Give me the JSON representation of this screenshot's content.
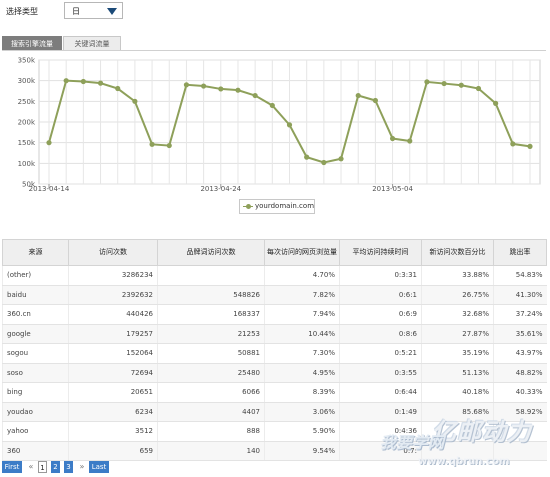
{
  "filter": {
    "label": "选择类型",
    "selected": "日"
  },
  "tabs": [
    {
      "label": "搜索引擎流量",
      "active": true
    },
    {
      "label": "关键词流量",
      "active": false
    }
  ],
  "chart_data": {
    "type": "line",
    "x": [
      "2013-04-14",
      "2013-04-15",
      "2013-04-16",
      "2013-04-17",
      "2013-04-18",
      "2013-04-19",
      "2013-04-20",
      "2013-04-21",
      "2013-04-22",
      "2013-04-23",
      "2013-04-24",
      "2013-04-25",
      "2013-04-26",
      "2013-04-27",
      "2013-04-28",
      "2013-04-29",
      "2013-04-30",
      "2013-05-01",
      "2013-05-02",
      "2013-05-03",
      "2013-05-04",
      "2013-05-05",
      "2013-05-06",
      "2013-05-07",
      "2013-05-08",
      "2013-05-09",
      "2013-05-10",
      "2013-05-11",
      "2013-05-12"
    ],
    "x_tick_labels": [
      "2013-04-14",
      "2013-04-24",
      "2013-05-04"
    ],
    "series": [
      {
        "name": "yourdomain.com",
        "color": "#8ea05a",
        "values": [
          150000,
          300000,
          298000,
          294000,
          281000,
          250000,
          146000,
          143000,
          290000,
          287000,
          280000,
          277000,
          264000,
          240000,
          193000,
          115000,
          102000,
          111000,
          264000,
          252000,
          160000,
          154000,
          297000,
          293000,
          289000,
          281000,
          245000,
          147000,
          141000
        ]
      }
    ],
    "ylim": [
      50000,
      350000
    ],
    "y_ticks": [
      "50k",
      "100k",
      "150k",
      "200k",
      "250k",
      "300k",
      "350k"
    ],
    "grid": true,
    "legend": "bottom-center"
  },
  "table": {
    "headers": [
      "来源",
      "访问次数",
      "品牌词访问次数",
      "每次访问的网页浏览量",
      "平均访问持续时间",
      "新访问次数百分比",
      "跳出率"
    ],
    "rows": [
      [
        "(other)",
        "3286234",
        "",
        "4.70%",
        "0:3:31",
        "33.88%",
        "54.83%"
      ],
      [
        "baidu",
        "2392632",
        "548826",
        "7.82%",
        "0:6:1",
        "26.75%",
        "41.30%"
      ],
      [
        "360.cn",
        "440426",
        "168337",
        "7.94%",
        "0:6:9",
        "32.68%",
        "37.24%"
      ],
      [
        "google",
        "179257",
        "21253",
        "10.44%",
        "0:8:6",
        "27.87%",
        "35.61%"
      ],
      [
        "sogou",
        "152064",
        "50881",
        "7.30%",
        "0:5:21",
        "35.19%",
        "43.97%"
      ],
      [
        "soso",
        "72694",
        "25480",
        "4.95%",
        "0:3:55",
        "51.13%",
        "48.82%"
      ],
      [
        "bing",
        "20651",
        "6066",
        "8.39%",
        "0:6:44",
        "40.18%",
        "40.33%"
      ],
      [
        "youdao",
        "6234",
        "4407",
        "3.06%",
        "0:1:49",
        "85.68%",
        "58.92%"
      ],
      [
        "yahoo",
        "3512",
        "888",
        "5.90%",
        "0:4:36",
        "",
        ""
      ],
      [
        "360",
        "659",
        "140",
        "9.54%",
        "0:7:",
        "",
        ""
      ]
    ]
  },
  "pager": {
    "first": "First",
    "prev": "«",
    "pages": [
      "1",
      "2",
      "3"
    ],
    "next": "»",
    "last": "Last"
  },
  "watermark": {
    "big": "亿邮动力",
    "mid": "我要学网",
    "url": "www.qbrun.com"
  }
}
